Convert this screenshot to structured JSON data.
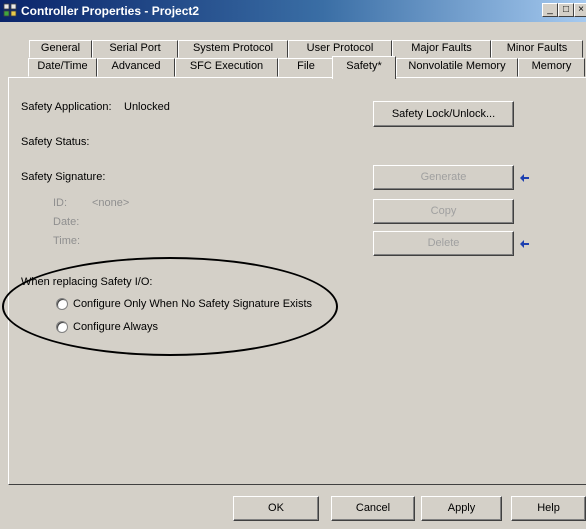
{
  "window": {
    "title": "Controller Properties - Project2",
    "min": "_",
    "max": "□",
    "close": "×"
  },
  "tabs_row1": [
    "General",
    "Serial Port",
    "System Protocol",
    "User Protocol",
    "Major Faults",
    "Minor Faults"
  ],
  "tabs_row2": [
    "Date/Time",
    "Advanced",
    "SFC Execution",
    "File",
    "Safety*",
    "Nonvolatile Memory",
    "Memory"
  ],
  "active_tab": "Safety*",
  "safety": {
    "application_label": "Safety Application:",
    "application_value": "Unlocked",
    "status_label": "Safety Status:",
    "signature_label": "Safety Signature:",
    "id_label": "ID:",
    "id_value": "<none>",
    "date_label": "Date:",
    "time_label": "Time:",
    "lock_button": "Safety Lock/Unlock...",
    "generate_button": "Generate",
    "copy_button": "Copy",
    "delete_button": "Delete"
  },
  "replacing": {
    "label": "When replacing Safety I/O:",
    "options": [
      "Configure Only When No Safety Signature Exists",
      "Configure Always"
    ]
  },
  "footer": {
    "ok": "OK",
    "cancel": "Cancel",
    "apply": "Apply",
    "help": "Help"
  },
  "colors": {
    "title_start": "#0a246a",
    "title_end": "#a6caf0",
    "face": "#d4d0c8",
    "arrow": "#1c3fb0"
  }
}
